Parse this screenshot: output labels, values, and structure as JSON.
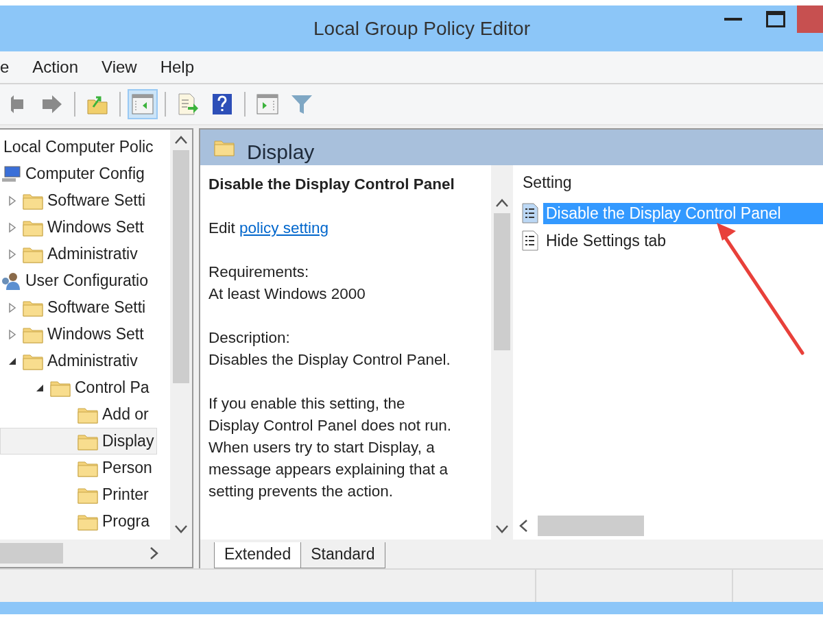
{
  "window": {
    "title": "Local Group Policy Editor"
  },
  "menu": [
    "e",
    "Action",
    "View",
    "Help"
  ],
  "toolbar": [
    {
      "pressed": false
    },
    {
      "pressed": false
    },
    {
      "pressed": false
    },
    {
      "pressed": true
    },
    {
      "pressed": false
    },
    {
      "pressed": false
    },
    {
      "pressed": false
    }
  ],
  "tree": [
    {
      "label": "Local Computer Polic",
      "selected": false,
      "children": [
        {
          "label": "Computer Config",
          "kind": "computer",
          "selected": false,
          "children": [
            {
              "label": "Software Setti",
              "kind": "folder",
              "selected": false,
              "expanded": false
            },
            {
              "label": "Windows Sett",
              "kind": "folder",
              "selected": false,
              "expanded": false
            },
            {
              "label": "Administrativ",
              "kind": "folder",
              "selected": false,
              "expanded": false
            }
          ]
        },
        {
          "label": "User Configuratio",
          "kind": "user",
          "selected": false,
          "children": [
            {
              "label": "Software Setti",
              "kind": "folder",
              "selected": false,
              "expanded": false
            },
            {
              "label": "Windows Sett",
              "kind": "folder",
              "selected": false,
              "expanded": false
            },
            {
              "label": "Administrativ",
              "kind": "folder",
              "selected": false,
              "expanded": true,
              "children": [
                {
                  "label": "Control Pa",
                  "kind": "folder",
                  "selected": false,
                  "expanded": true,
                  "children": [
                    {
                      "label": "Add or",
                      "kind": "folder",
                      "selected": false
                    },
                    {
                      "label": "Display",
                      "kind": "folder",
                      "selected": true
                    },
                    {
                      "label": "Person",
                      "kind": "folder",
                      "selected": false
                    },
                    {
                      "label": "Printer",
                      "kind": "folder",
                      "selected": false
                    },
                    {
                      "label": "Progra",
                      "kind": "folder",
                      "selected": false
                    }
                  ]
                }
              ]
            }
          ]
        }
      ]
    }
  ],
  "pane": {
    "title": "Display",
    "description": {
      "heading": "Disable the Display Control Panel",
      "edit_prefix": "Edit",
      "edit_link": "policy setting",
      "requirements_label": "Requirements:",
      "requirements": "At least Windows 2000",
      "description_label": "Description:",
      "description": "Disables the Display Control Panel.",
      "body": "If you enable this setting, the Display Control Panel does not run. When users try to start Display, a message appears explaining that a setting prevents the action."
    },
    "list": {
      "column": "Setting",
      "rows": [
        {
          "label": "Disable the Display Control Panel",
          "selected": true
        },
        {
          "label": "Hide Settings tab",
          "selected": false
        }
      ]
    },
    "tabs": [
      {
        "label": "Extended",
        "selected": true
      },
      {
        "label": "Standard",
        "selected": false
      }
    ]
  }
}
